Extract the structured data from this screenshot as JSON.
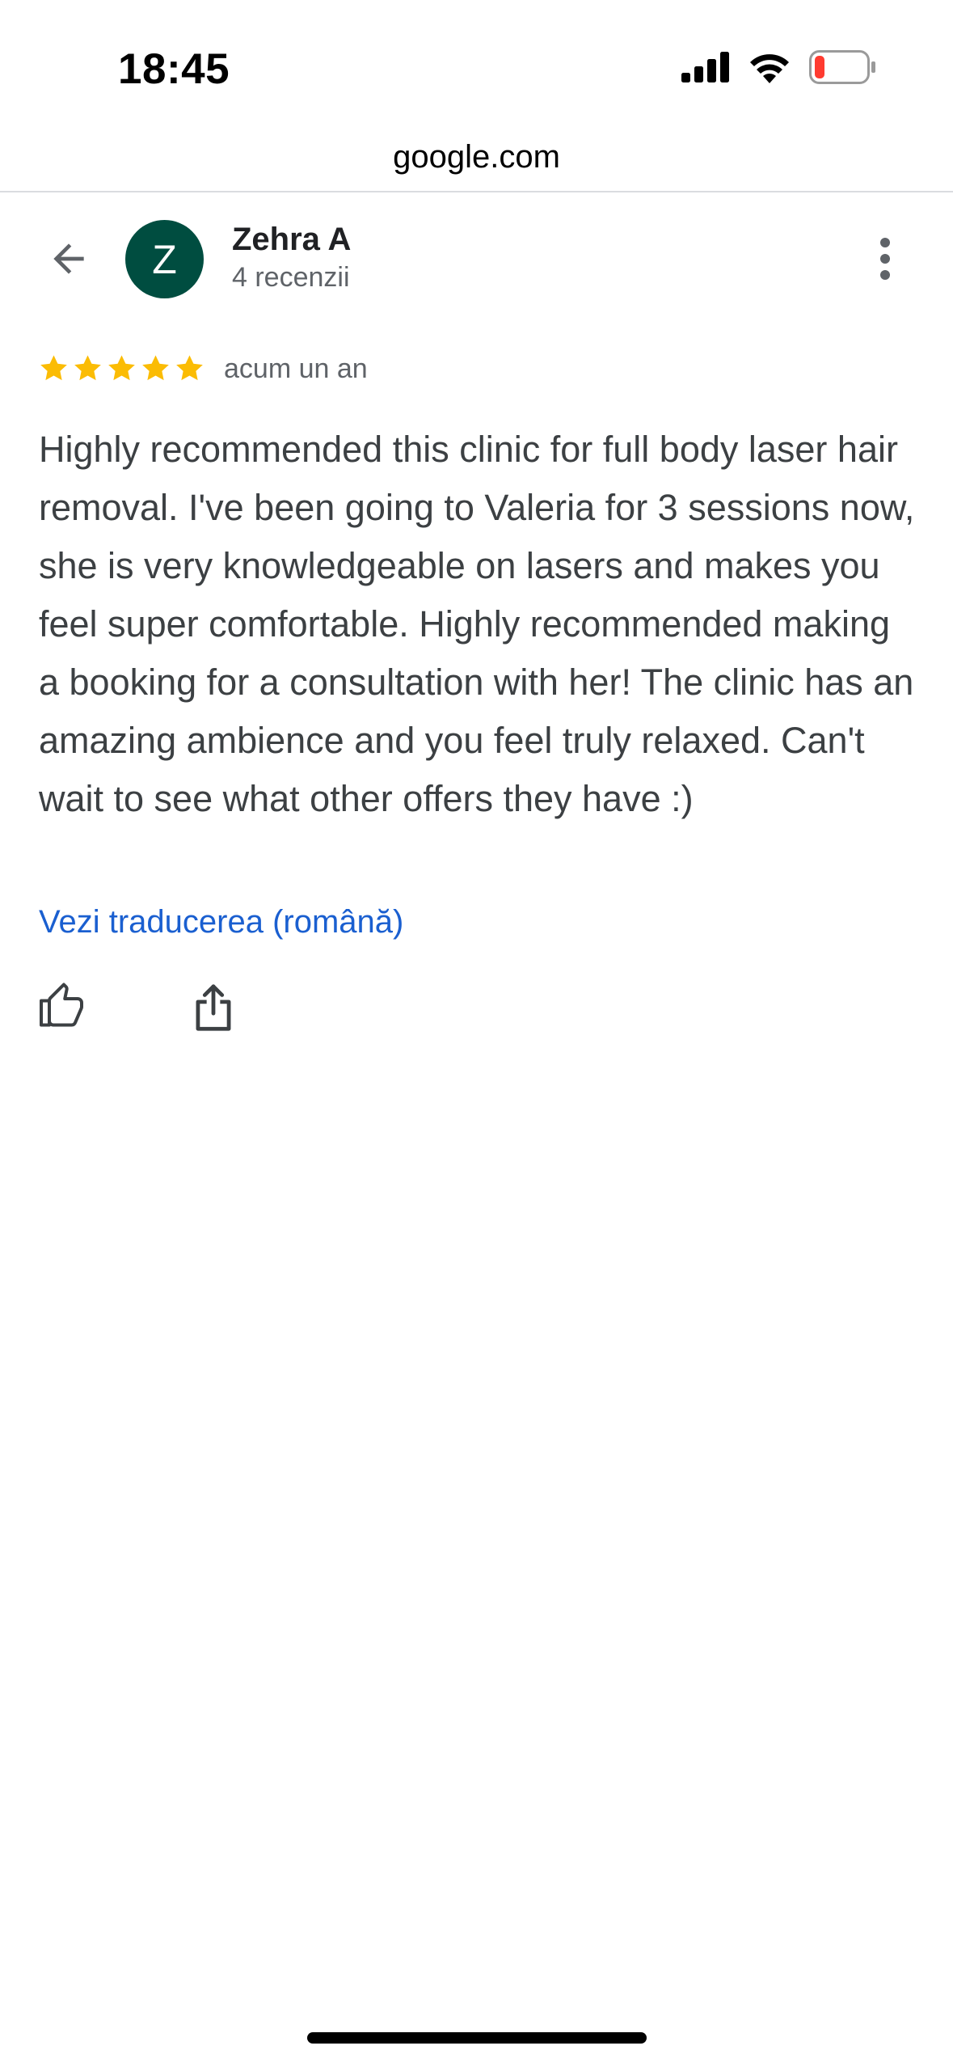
{
  "status_bar": {
    "time": "18:45",
    "signal_icon": "cellular-signal-icon",
    "wifi_icon": "wifi-icon",
    "battery_icon": "battery-low-icon",
    "battery_color": "#ff3b30"
  },
  "browser": {
    "url": "google.com"
  },
  "header": {
    "back_icon": "arrow-back-icon",
    "avatar_initial": "Z",
    "avatar_color": "#004d40",
    "reviewer_name": "Zehra A",
    "review_count": "4 recenzii",
    "more_icon": "more-vert-icon"
  },
  "review": {
    "rating": 5,
    "max_rating": 5,
    "star_color": "#fbbc04",
    "date": "acum un an",
    "text": "Highly recommended this clinic for full body laser hair removal. I've been going to Valeria for 3 sessions now, she is very knowledgeable on lasers and makes you feel super comfortable. Highly recommended making a booking for a consultation with her! The clinic has an amazing ambience and you feel truly relaxed. Can't wait to see what other offers they have :)",
    "translate_label": "Vezi traducerea (română)",
    "link_color": "#1a5fd0"
  },
  "actions": {
    "like_icon": "thumb-up-icon",
    "share_icon": "share-icon"
  }
}
